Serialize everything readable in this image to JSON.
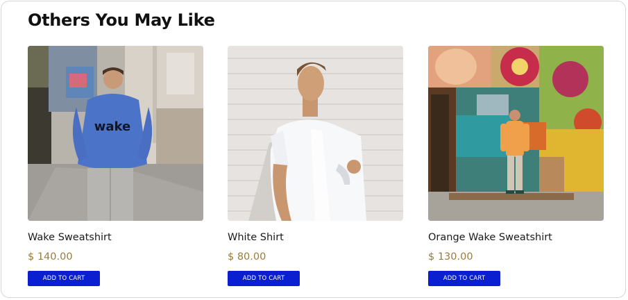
{
  "section": {
    "title": "Others You May Like"
  },
  "products": [
    {
      "name": "Wake Sweatshirt",
      "price": "$ 140.00",
      "button_label": "ADD TO CART",
      "graphic_text": "wake"
    },
    {
      "name": "White Shirt",
      "price": "$ 80.00",
      "button_label": "ADD TO CART"
    },
    {
      "name": "Orange Wake Sweatshirt",
      "price": "$ 130.00",
      "button_label": "ADD TO CART"
    }
  ],
  "colors": {
    "button": "#0a1fd0",
    "price": "#9c7a3c",
    "title": "#111111"
  }
}
